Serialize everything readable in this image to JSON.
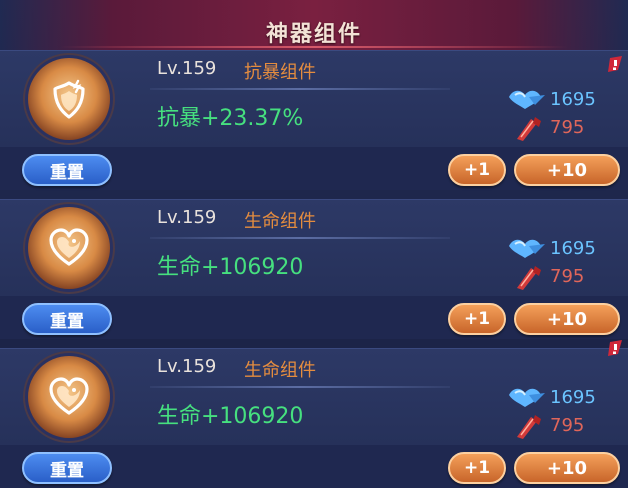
{
  "header": {
    "title": "神器组件"
  },
  "components": [
    {
      "level": "Lv.159",
      "name": "抗暴组件",
      "stat": "抗暴+23.37%",
      "icon": "shield-crest-icon",
      "cost_blue": "1695",
      "cost_red": "795",
      "alert": true,
      "reset_label": "重置",
      "plus1_label": "+1",
      "plus10_label": "+10"
    },
    {
      "level": "Lv.159",
      "name": "生命组件",
      "stat": "生命+106920",
      "icon": "heart-crest-icon",
      "cost_blue": "1695",
      "cost_red": "795",
      "alert": false,
      "reset_label": "重置",
      "plus1_label": "+1",
      "plus10_label": "+10"
    },
    {
      "level": "Lv.159",
      "name": "生命组件",
      "stat": "生命+106920",
      "icon": "heart-crest-icon",
      "cost_blue": "1695",
      "cost_red": "795",
      "alert": true,
      "reset_label": "重置",
      "plus1_label": "+1",
      "plus10_label": "+10"
    }
  ],
  "colors": {
    "level_text": "#e9e2dc",
    "name_text": "#e48c3f",
    "stat_text": "#46e07f",
    "blue_cost": "#6bc4ff",
    "red_cost": "#e0665a"
  }
}
